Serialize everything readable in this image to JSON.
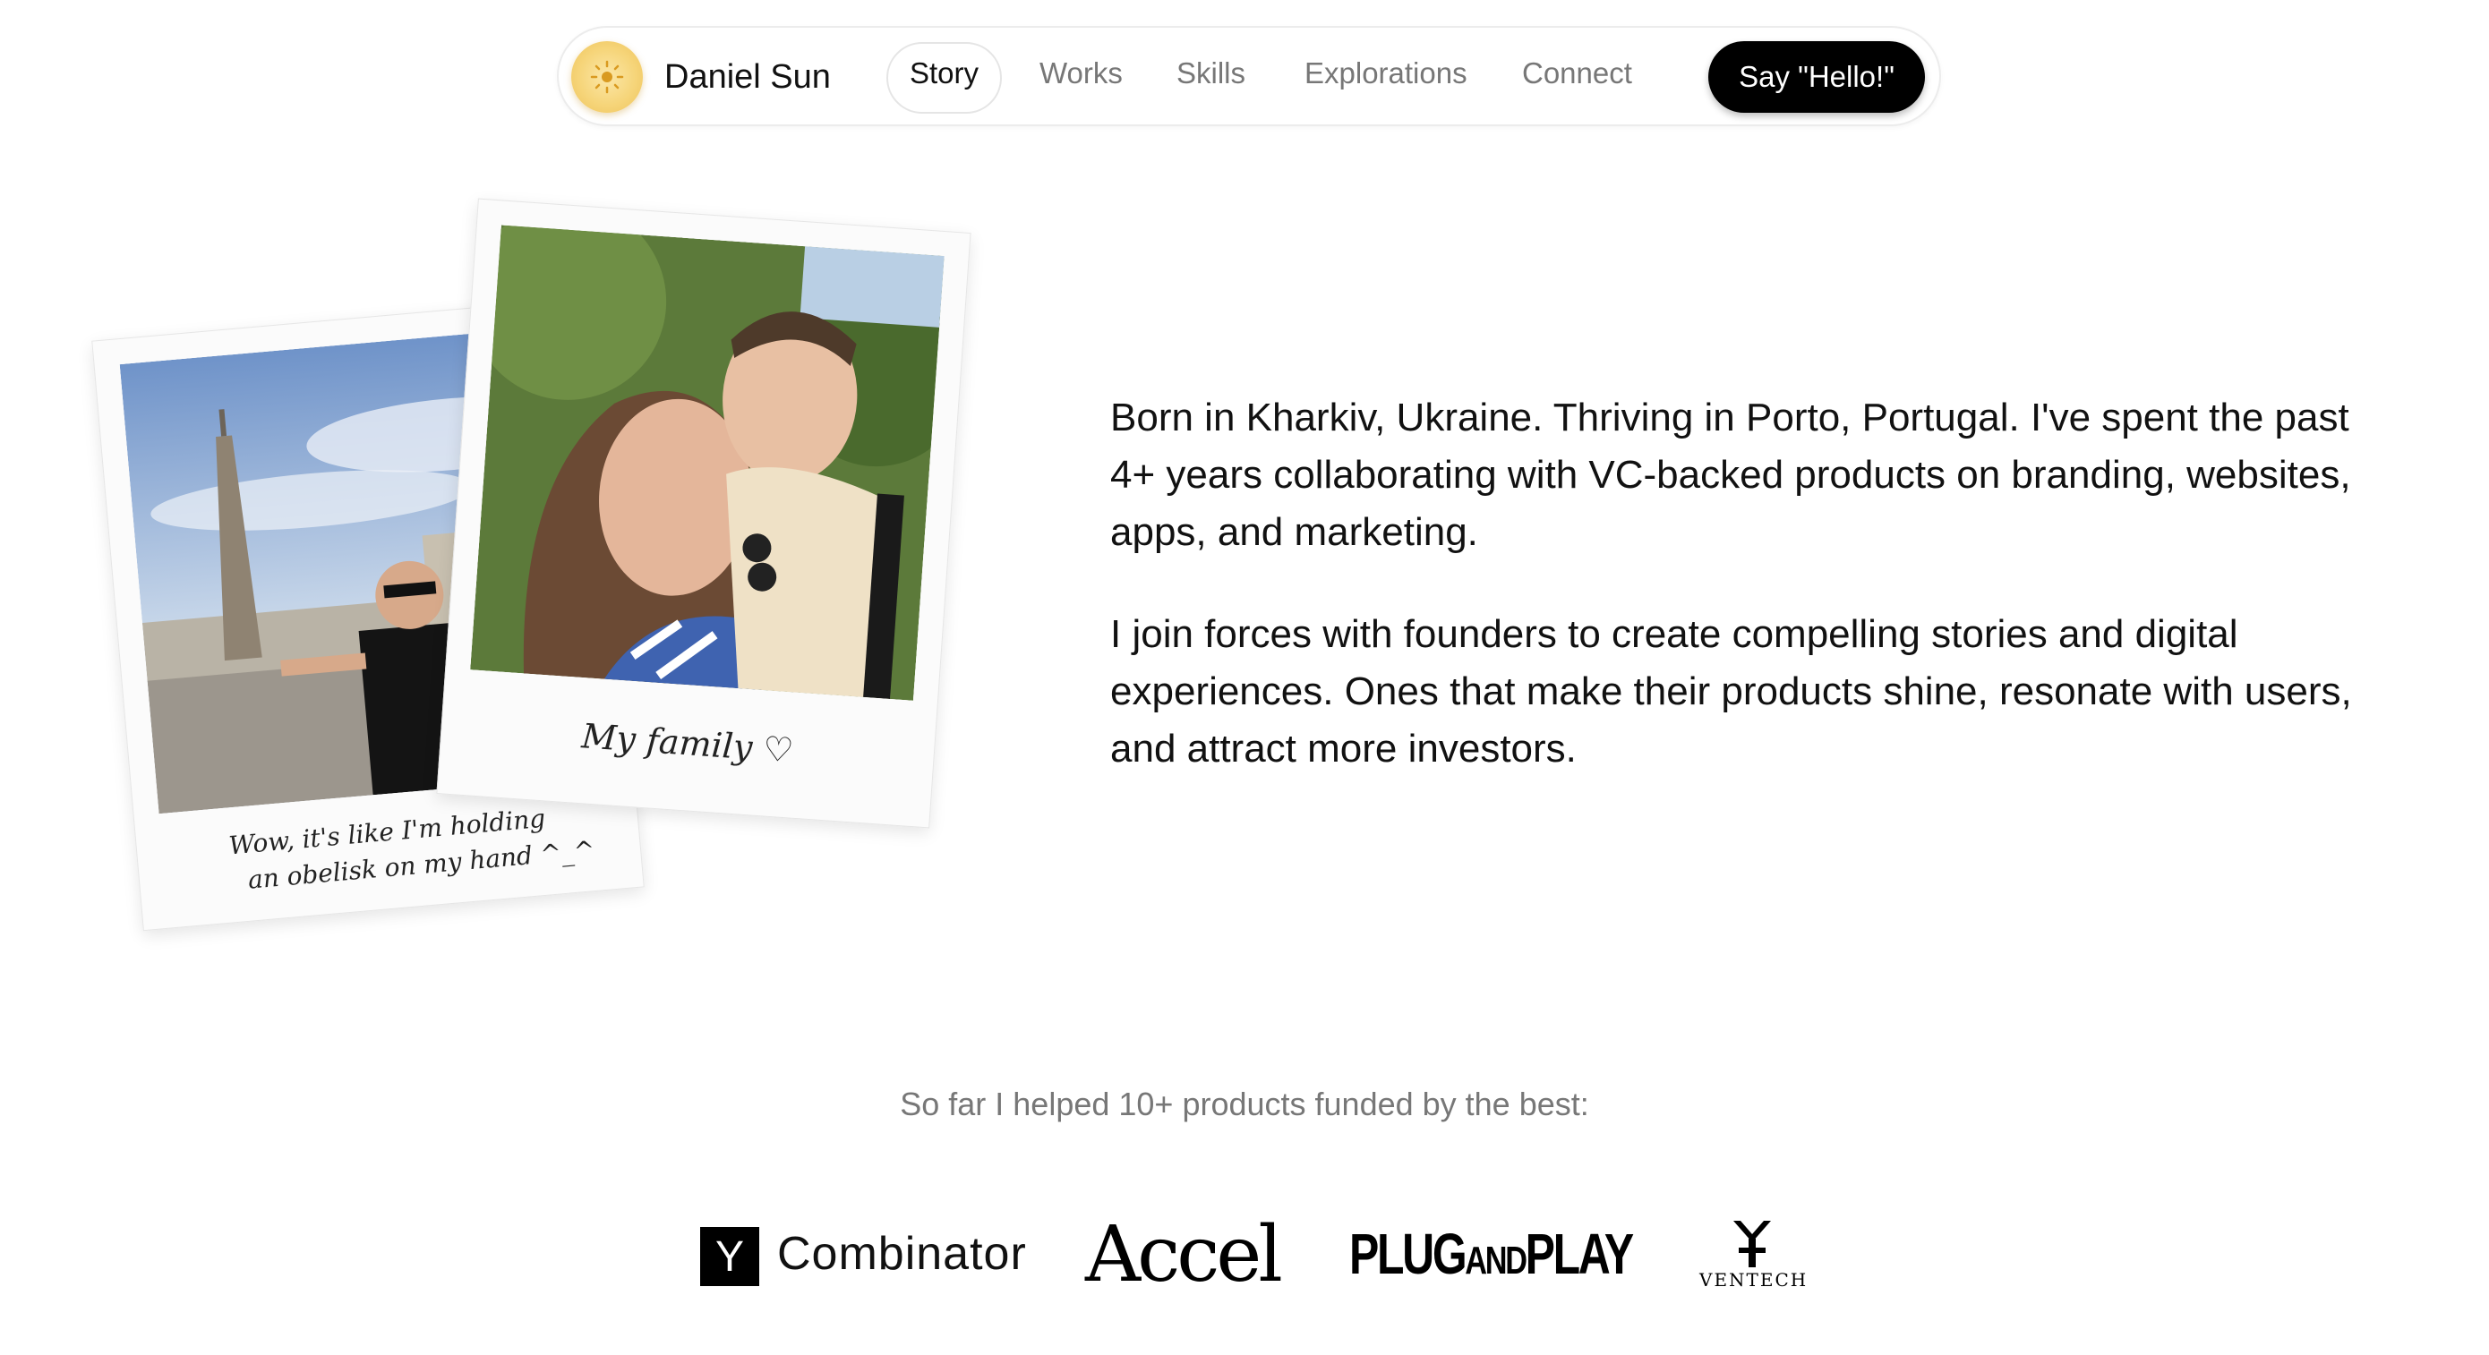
{
  "nav": {
    "brand": "Daniel Sun",
    "links": [
      {
        "label": "Story",
        "active": true
      },
      {
        "label": "Works",
        "active": false
      },
      {
        "label": "Skills",
        "active": false
      },
      {
        "label": "Explorations",
        "active": false
      },
      {
        "label": "Connect",
        "active": false
      }
    ],
    "cta_label": "Say \"Hello!\""
  },
  "polaroids": [
    {
      "caption_line1": "Wow, it's like I'm holding",
      "caption_line2": "an obelisk on my hand ^_^"
    },
    {
      "caption": "My family ♡"
    }
  ],
  "bio": {
    "paragraph1": "Born in Kharkiv, Ukraine. Thriving in Porto, Portugal. I've spent the past 4+ years collaborating with VC-backed products on branding, websites, apps, and marketing.",
    "paragraph2": "I join forces with founders to create compelling stories and digital experiences. Ones that make their products shine, resonate with users, and attract more investors."
  },
  "funded": {
    "heading": "So far I helped 10+ products funded by the best:",
    "logos": {
      "yc_mark": "Y",
      "yc_text": "Combinator",
      "accel": "Accel",
      "pnp_plug": "PLUG",
      "pnp_and": "AND",
      "pnp_play": "PLAY",
      "ventech": "VENTECH"
    }
  }
}
